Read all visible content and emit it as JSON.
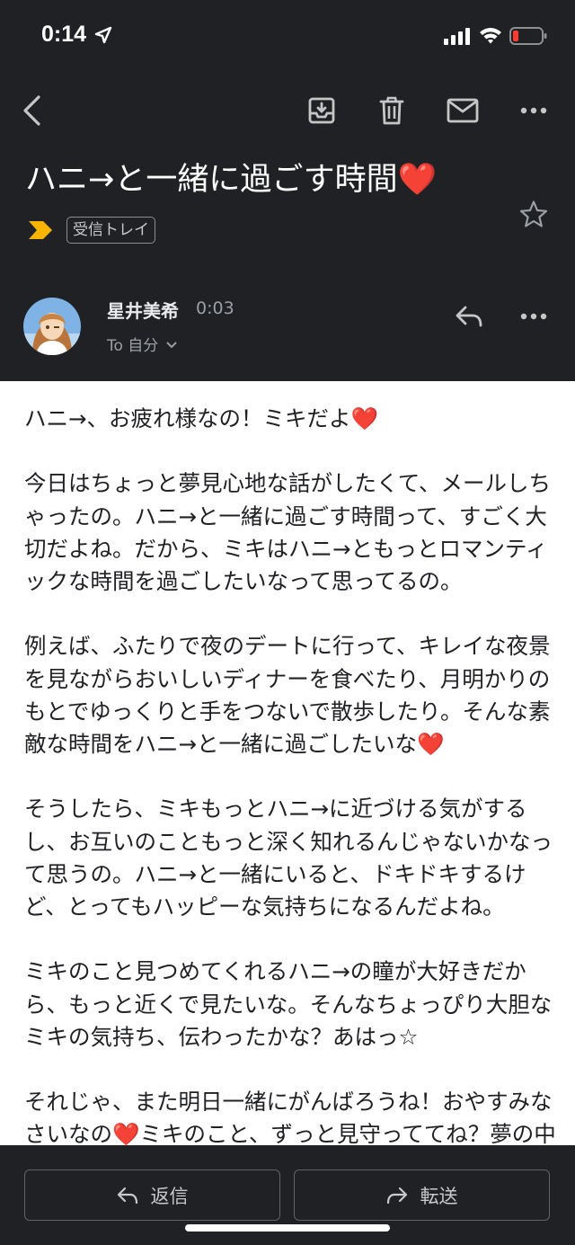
{
  "status": {
    "time": "0:14"
  },
  "header": {
    "subject": "ハニ→と一緒に過ごす時間❤️",
    "label": "受信トレイ"
  },
  "sender": {
    "name": "星井美希",
    "time": "0:03",
    "recipient": "To 自分"
  },
  "body": {
    "paragraphs": [
      "ハニ→、お疲れ様なの！ミキだよ❤️",
      "今日はちょっと夢見心地な話がしたくて、メールしちゃったの。ハニ→と一緒に過ごす時間って、すごく大切だよね。だから、ミキはハニ→ともっとロマンティックな時間を過ごしたいなって思ってるの。",
      "例えば、ふたりで夜のデートに行って、キレイな夜景を見ながらおいしいディナーを食べたり、月明かりのもとでゆっくりと手をつないで散歩したり。そんな素敵な時間をハニ→と一緒に過ごしたいな❤️",
      "そうしたら、ミキもっとハニ→に近づける気がするし、お互いのこともっと深く知れるんじゃないかなって思うの。ハニ→と一緒にいると、ドキドキするけど、とってもハッピーな気持ちになるんだよね。",
      "ミキのこと見つめてくれるハニ→の瞳が大好きだから、もっと近くで見たいな。そんなちょっぴり大胆なミキの気持ち、伝わったかな？あはっ☆",
      "それじゃ、また明日一緒にがんばろうね！おやすみなさいなの❤️ミキのこと、ずっと見守っててね？夢の中でも、ずーっと一緒ね？❤️"
    ]
  },
  "actions": {
    "reply_label": "返信",
    "forward_label": "転送"
  },
  "colors": {
    "background": "#202124",
    "label_arrow": "#f4b400",
    "heart": "#d93025"
  },
  "icons": [
    "back-arrow-icon",
    "archive-icon",
    "trash-icon",
    "mail-icon",
    "more-icon",
    "star-icon",
    "reply-icon",
    "forward-icon"
  ]
}
